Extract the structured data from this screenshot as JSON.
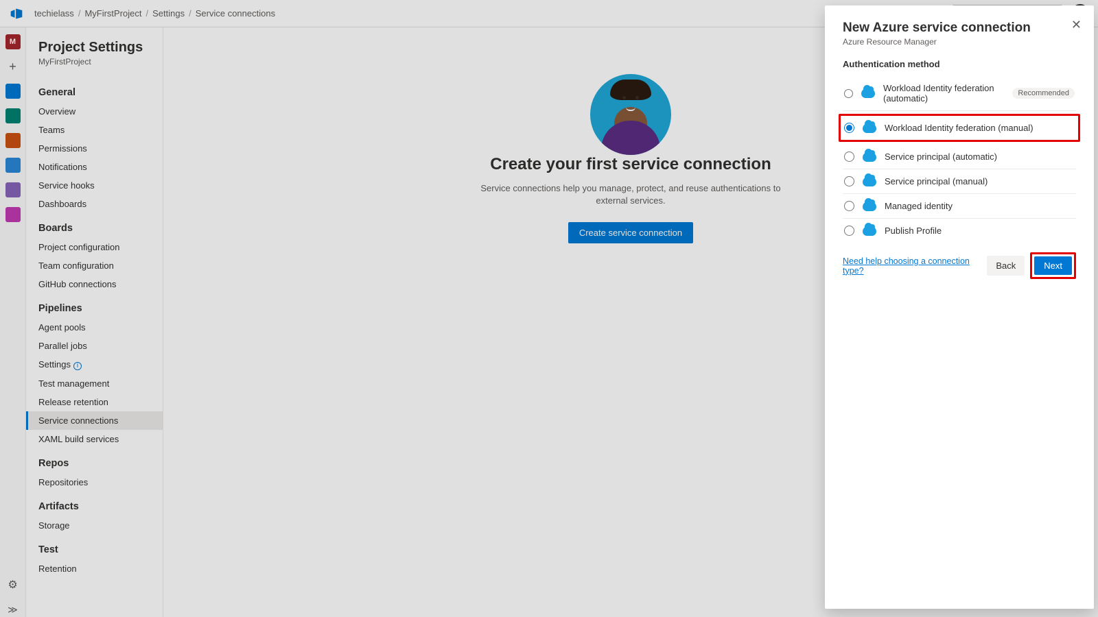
{
  "breadcrumb": {
    "org": "techielass",
    "project": "MyFirstProject",
    "section": "Settings",
    "page": "Service connections"
  },
  "project_letter": "M",
  "sidebar": {
    "title": "Project Settings",
    "project": "MyFirstProject",
    "groups": [
      {
        "header": "General",
        "items": [
          "Overview",
          "Teams",
          "Permissions",
          "Notifications",
          "Service hooks",
          "Dashboards"
        ]
      },
      {
        "header": "Boards",
        "items": [
          "Project configuration",
          "Team configuration",
          "GitHub connections"
        ]
      },
      {
        "header": "Pipelines",
        "items": [
          "Agent pools",
          "Parallel jobs",
          "Settings",
          "Test management",
          "Release retention",
          "Service connections",
          "XAML build services"
        ]
      },
      {
        "header": "Repos",
        "items": [
          "Repositories"
        ]
      },
      {
        "header": "Artifacts",
        "items": [
          "Storage"
        ]
      },
      {
        "header": "Test",
        "items": [
          "Retention"
        ]
      }
    ],
    "active": "Service connections",
    "info_badge_on": "Settings"
  },
  "main": {
    "title": "Create your first service connection",
    "desc": "Service connections help you manage, protect, and reuse authentications to external services.",
    "button": "Create service connection"
  },
  "panel": {
    "title": "New Azure service connection",
    "subtitle": "Azure Resource Manager",
    "section": "Authentication method",
    "options": [
      {
        "label": "Workload Identity federation (automatic)",
        "recommended": true,
        "selected": false,
        "highlighted": false
      },
      {
        "label": "Workload Identity federation (manual)",
        "recommended": false,
        "selected": true,
        "highlighted": true
      },
      {
        "label": "Service principal (automatic)",
        "recommended": false,
        "selected": false,
        "highlighted": false
      },
      {
        "label": "Service principal (manual)",
        "recommended": false,
        "selected": false,
        "highlighted": false
      },
      {
        "label": "Managed identity",
        "recommended": false,
        "selected": false,
        "highlighted": false
      },
      {
        "label": "Publish Profile",
        "recommended": false,
        "selected": false,
        "highlighted": false
      }
    ],
    "recommended_badge": "Recommended",
    "help": "Need help choosing a connection type?",
    "back": "Back",
    "next": "Next",
    "next_highlighted": true
  }
}
